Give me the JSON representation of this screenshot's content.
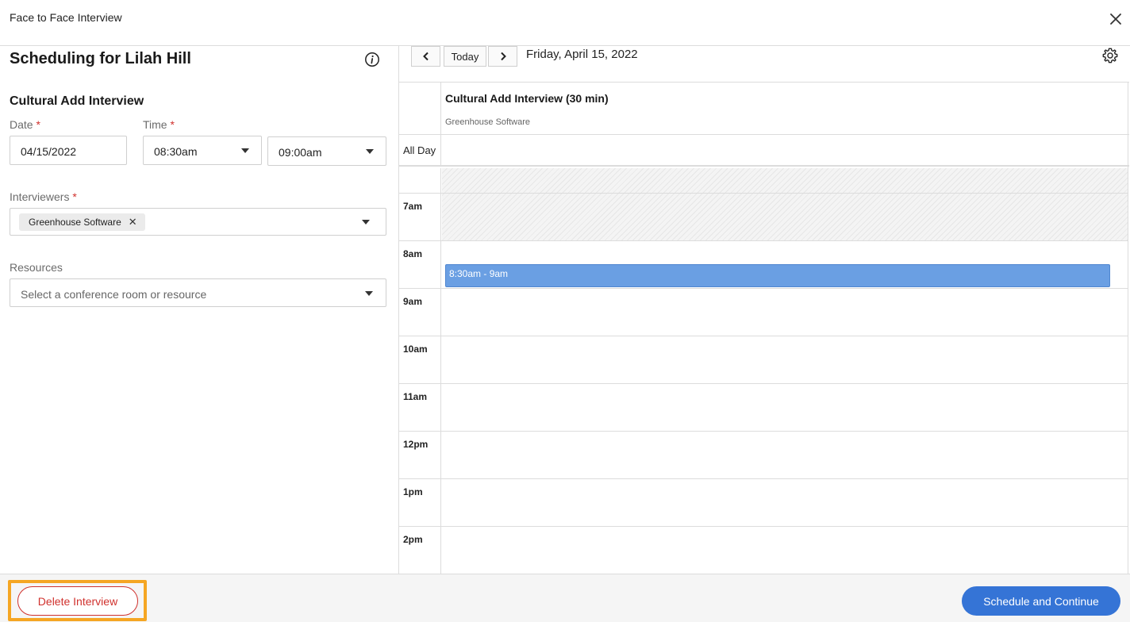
{
  "modal": {
    "title": "Face to Face Interview"
  },
  "form": {
    "heading": "Scheduling for Lilah Hill",
    "interview_name": "Cultural Add Interview",
    "date": {
      "label": "Date",
      "required_mark": "*",
      "value": "04/15/2022"
    },
    "time": {
      "label": "Time",
      "required_mark": "*",
      "start": "08:30am",
      "end": "09:00am"
    },
    "interviewers": {
      "label": "Interviewers",
      "required_mark": "*",
      "chips": [
        "Greenhouse Software"
      ]
    },
    "resources": {
      "label": "Resources",
      "placeholder": "Select a conference room or resource"
    }
  },
  "calendar": {
    "today_label": "Today",
    "current_date": "Friday, April 15, 2022",
    "column_title": "Cultural Add Interview (30 min)",
    "column_subtitle": "Greenhouse Software",
    "all_day_label": "All Day",
    "hours": [
      "7am",
      "8am",
      "9am",
      "10am",
      "11am",
      "12pm",
      "1pm",
      "2pm"
    ],
    "event_label": "8:30am - 9am"
  },
  "footer": {
    "delete_label": "Delete Interview",
    "primary_label": "Schedule and Continue"
  },
  "colors": {
    "accent": "#3574d6",
    "danger": "#d0312d",
    "event": "#6a9fe3",
    "highlight": "#f5a623"
  }
}
